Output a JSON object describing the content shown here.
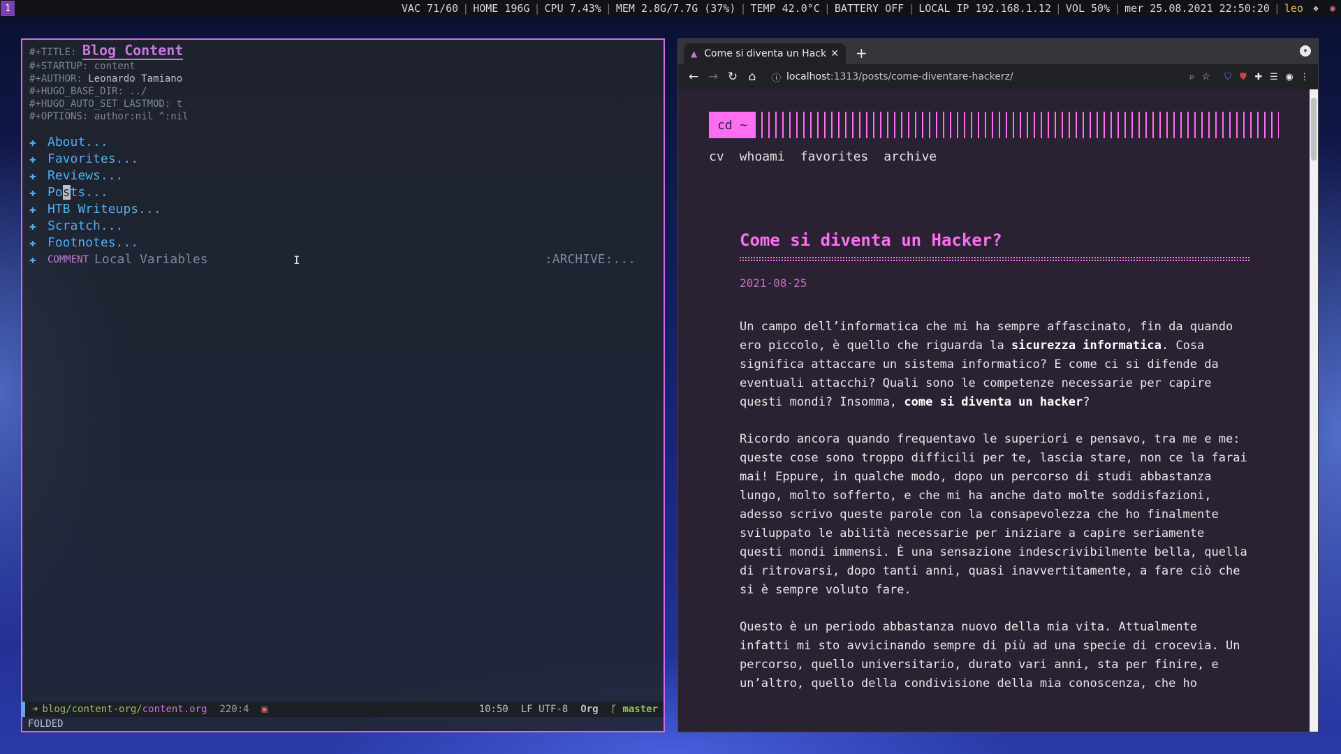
{
  "topbar": {
    "workspace": "1",
    "items": [
      "VAC 71/60",
      "HOME 196G",
      "CPU 7.43%",
      "MEM 2.8G/7.7G (37%)",
      "TEMP 42.0°C",
      "BATTERY OFF",
      "LOCAL IP 192.168.1.12",
      "VOL 50%",
      "mer 25.08.2021 22:50:20"
    ],
    "user": "leo"
  },
  "emacs": {
    "keywords": {
      "title_key": "#+TITLE:",
      "title_val": "Blog Content",
      "startup": "#+STARTUP: content",
      "author_key": "#+AUTHOR:",
      "author_val": "Leonardo Tamiano",
      "hugo_base_dir": "#+HUGO_BASE_DIR: ../",
      "hugo_auto_set_lastmod": "#+HUGO_AUTO_SET_LASTMOD: t",
      "options": "#+OPTIONS: author:nil ^:nil"
    },
    "headings": [
      "About...",
      "Favorites...",
      "Reviews...",
      "Posts...",
      "HTB Writeups...",
      "Scratch...",
      "Footnotes..."
    ],
    "comment_heading": {
      "tag": "COMMENT",
      "title": "Local Variables",
      "tags": ":ARCHIVE:..."
    },
    "bullet_icon": "plus-bullet-icon",
    "modeline": {
      "dir": "blog/content-org/",
      "file": "content.org",
      "position": "220:4",
      "time": "10:50",
      "encoding": "LF UTF-8",
      "mode": "Org",
      "branch": "master"
    },
    "echo": "FOLDED",
    "colors": {
      "border": "#d26ce6",
      "heading": "#51afef",
      "title": "#c678dd"
    }
  },
  "browser": {
    "tab_title": "Come si diventa un Hacker?",
    "url_host": "localhost",
    "url_rest": ":1313/posts/come-diventare-hackerz/",
    "page": {
      "logo": "cd ~",
      "nav": [
        "cv",
        "whoami",
        "favorites",
        "archive"
      ],
      "post_title": "Come si diventa un Hacker?",
      "post_date": "2021-08-25",
      "p1_a": "Un campo dell’informatica che mi ha sempre affascinato, fin da quando ero piccolo, è quello che riguarda la ",
      "p1_b": "sicurezza informatica",
      "p1_c": ". Cosa significa attaccare un sistema informatico? E come ci si difende da eventuali attacchi? Quali sono le competenze necessarie per capire questi mondi? Insomma, ",
      "p1_d": "come si diventa un hacker",
      "p1_e": "?",
      "p2": "Ricordo ancora quando frequentavo le superiori e pensavo, tra me e me: queste cose sono troppo difficili per te, lascia stare, non ce la farai mai! Eppure, in qualche modo, dopo un percorso di studi abbastanza lungo, molto sofferto, e che mi ha anche dato molte soddisfazioni, adesso scrivo queste parole con la consapevolezza che ho finalmente sviluppato le abilità necessarie per iniziare a capire seriamente questi mondi immensi. È una sensazione indescrivibilmente bella, quella di ritrovarsi, dopo tanti anni, quasi inavvertitamente, a fare ciò che si è sempre voluto fare.",
      "p3": "Questo è un periodo abbastanza nuovo della mia vita. Attualmente infatti mi sto avvicinando sempre di più ad una specie di crocevia. Un percorso, quello universitario, durato vari anni, sta per finire, e un’altro, quello della condivisione della mia conoscenza, che ho",
      "accent": "#ff6ef2"
    }
  }
}
